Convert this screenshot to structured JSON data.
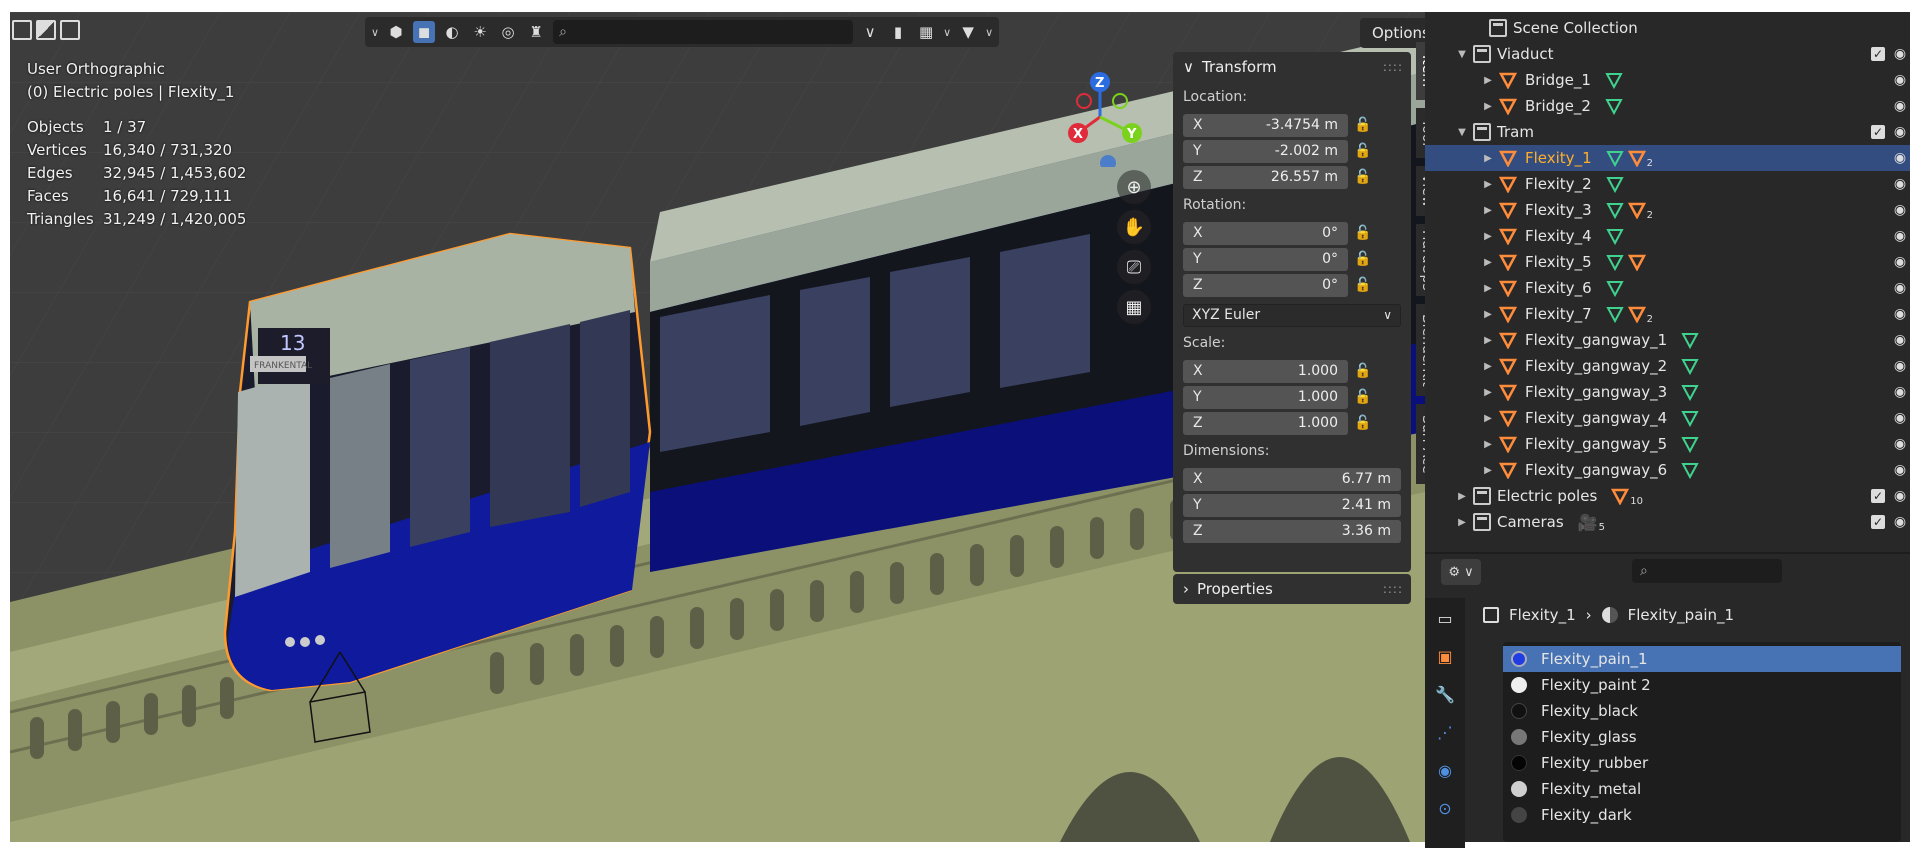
{
  "viewport": {
    "view_name": "User Orthographic",
    "context": "(0) Electric poles | Flexity_1",
    "stats": [
      {
        "label": "Objects",
        "value": "1 / 37"
      },
      {
        "label": "Vertices",
        "value": "16,340 / 731,320"
      },
      {
        "label": "Edges",
        "value": "32,945 / 1,453,602"
      },
      {
        "label": "Faces",
        "value": "16,641 / 729,111"
      },
      {
        "label": "Triangles",
        "value": "31,249 / 1,420,005"
      }
    ],
    "options_label": "Options",
    "tram_display_number": "13",
    "tram_destination": "FRANKENTAL",
    "gizmo": {
      "x": "X",
      "y": "Y",
      "z": "Z"
    }
  },
  "transform_panel": {
    "title": "Transform",
    "location_label": "Location:",
    "location": {
      "x": "-3.4754 m",
      "y": "-2.002 m",
      "z": "26.557 m"
    },
    "rotation_label": "Rotation:",
    "rotation": {
      "x": "0°",
      "y": "0°",
      "z": "0°"
    },
    "rotation_mode": "XYZ Euler",
    "scale_label": "Scale:",
    "scale": {
      "x": "1.000",
      "y": "1.000",
      "z": "1.000"
    },
    "dimensions_label": "Dimensions:",
    "dimensions": {
      "x": "6.77 m",
      "y": "2.41 m",
      "z": "3.36 m"
    },
    "axis": {
      "x": "X",
      "y": "Y",
      "z": "Z"
    }
  },
  "properties_panel": {
    "title": "Properties"
  },
  "sidebar_tabs": [
    "Item",
    "Tool",
    "View",
    "HardOps",
    "BlenderKit",
    "Surf Ace"
  ],
  "outliner": {
    "root": "Scene Collection",
    "viaduct": "Viaduct",
    "bridge_1": "Bridge_1",
    "bridge_2": "Bridge_2",
    "tram": "Tram",
    "objects": [
      "Flexity_1",
      "Flexity_2",
      "Flexity_3",
      "Flexity_4",
      "Flexity_5",
      "Flexity_6",
      "Flexity_7",
      "Flexity_gangway_1",
      "Flexity_gangway_2",
      "Flexity_gangway_3",
      "Flexity_gangway_4",
      "Flexity_gangway_5",
      "Flexity_gangway_6"
    ],
    "electric_poles": "Electric poles",
    "electric_poles_count": "10",
    "cameras": "Cameras",
    "cameras_count": "5",
    "mod_count": "2"
  },
  "properties_editor": {
    "object_name": "Flexity_1",
    "material_name": "Flexity_pain_1",
    "materials": [
      {
        "name": "Flexity_pain_1",
        "color": "#1f3de0"
      },
      {
        "name": "Flexity_paint 2",
        "color": "#eeeeee"
      },
      {
        "name": "Flexity_black",
        "color": "#111111"
      },
      {
        "name": "Flexity_glass",
        "color": "#777777"
      },
      {
        "name": "Flexity_rubber",
        "color": "#050505"
      },
      {
        "name": "Flexity_metal",
        "color": "#cfcfcf"
      },
      {
        "name": "Flexity_dark",
        "color": "#444444"
      }
    ]
  },
  "colors": {
    "selection_outline": "#ff9a2e",
    "selected_row": "#334d80",
    "active_highlight": "#4772b3",
    "mesh_icon": "#ff8c3a",
    "modifier_icon": "#3fd28f"
  }
}
